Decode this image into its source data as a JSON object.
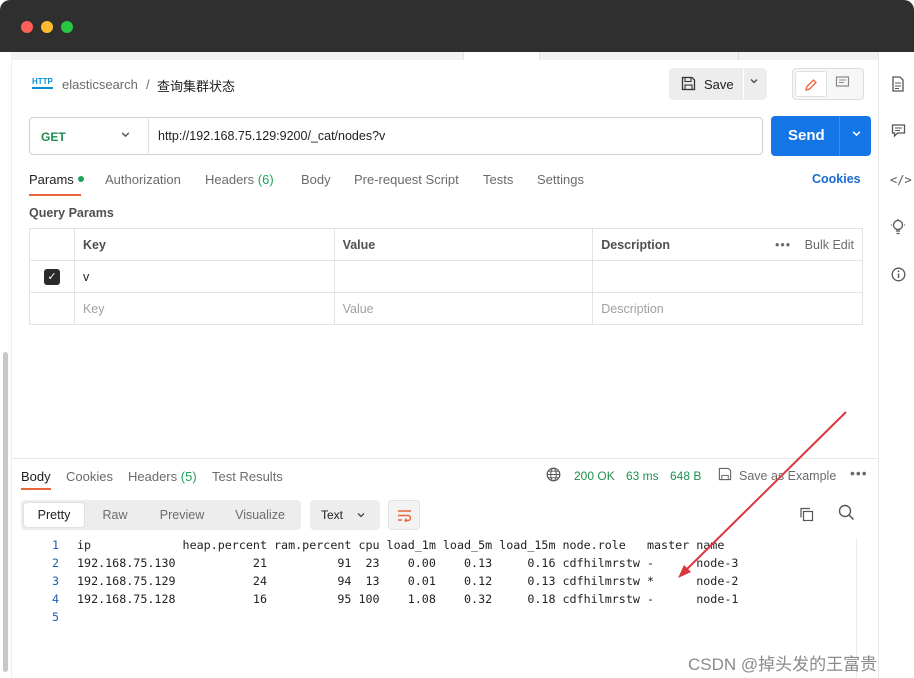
{
  "window": {
    "lights": [
      "#fe5f57",
      "#febc2e",
      "#28c840"
    ]
  },
  "breadcrumb": {
    "icon_text": "HTTP",
    "collection": "elasticsearch",
    "separator": "/",
    "request_name": "查询集群状态"
  },
  "toolbar": {
    "save_label": "Save"
  },
  "request": {
    "method": "GET",
    "url": "http://192.168.75.129:9200/_cat/nodes?v",
    "send_label": "Send"
  },
  "tabs": {
    "params": "Params",
    "authorization": "Authorization",
    "headers": "Headers",
    "headers_count": "(6)",
    "body": "Body",
    "prerequest": "Pre-request Script",
    "tests": "Tests",
    "settings": "Settings",
    "cookies": "Cookies"
  },
  "query_params": {
    "title": "Query Params",
    "headers": {
      "key": "Key",
      "value": "Value",
      "description": "Description",
      "bulk_edit": "Bulk Edit",
      "more": "•••"
    },
    "rows": [
      {
        "checked": true,
        "key": "v",
        "value": "",
        "description": ""
      }
    ],
    "placeholders": {
      "key": "Key",
      "value": "Value",
      "description": "Description"
    }
  },
  "response": {
    "tabs": {
      "body": "Body",
      "cookies": "Cookies",
      "headers": "Headers",
      "headers_count": "(5)",
      "test_results": "Test Results"
    },
    "status": "200 OK",
    "time": "63 ms",
    "size": "648 B",
    "save_example": "Save as Example",
    "more": "•••",
    "formats": {
      "pretty": "Pretty",
      "raw": "Raw",
      "preview": "Preview",
      "visualize": "Visualize"
    },
    "lang": "Text",
    "lines": [
      {
        "n": "1",
        "text": "ip             heap.percent ram.percent cpu load_1m load_5m load_15m node.role   master name"
      },
      {
        "n": "2",
        "text": "192.168.75.130           21          91  23    0.00    0.13     0.16 cdfhilmrstw -      node-3"
      },
      {
        "n": "3",
        "text": "192.168.75.129           24          94  13    0.01    0.12     0.13 cdfhilmrstw *      node-2"
      },
      {
        "n": "4",
        "text": "192.168.75.128           16          95 100    1.08    0.32     0.18 cdfhilmrstw -      node-1"
      },
      {
        "n": "5",
        "text": ""
      }
    ]
  },
  "annotation_color": "#d9363e",
  "watermark": "CSDN @掉头发的王富贵"
}
